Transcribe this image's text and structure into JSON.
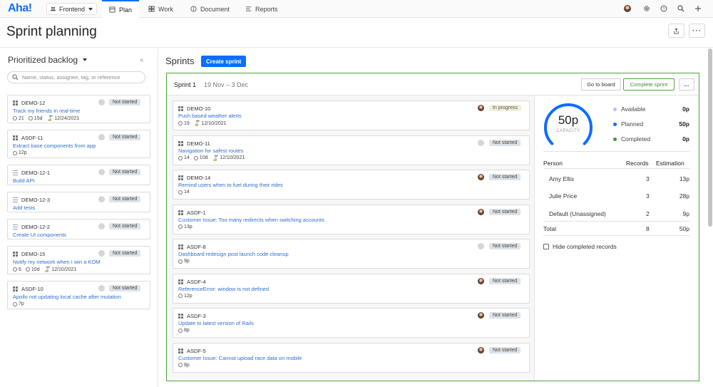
{
  "app": {
    "logo": "Aha!",
    "workspace": "Frontend",
    "tabs": [
      {
        "label": "Plan",
        "icon": "plan-icon",
        "active": true
      },
      {
        "label": "Work",
        "icon": "grid-icon",
        "active": false
      },
      {
        "label": "Document",
        "icon": "info-icon",
        "active": false
      },
      {
        "label": "Reports",
        "icon": "reports-icon",
        "active": false
      }
    ]
  },
  "page": {
    "title": "Sprint planning"
  },
  "backlog": {
    "title": "Prioritized backlog",
    "search_placeholder": "Name, status, assignee, tag, or reference",
    "items": [
      {
        "id": "DEMO-12",
        "icon": "grid",
        "title": "Track my friends in real-time",
        "status": "Not started",
        "meta": {
          "score": "21",
          "days": "15d",
          "date": "12/24/2021"
        }
      },
      {
        "id": "ASDF-11",
        "icon": "grid",
        "title": "Extract base components from app",
        "status": "Not started",
        "meta": {
          "estimate": "12p"
        }
      },
      {
        "id": "DEMO-12-1",
        "icon": "list",
        "title": "Build API",
        "status": "Not started"
      },
      {
        "id": "DEMO-12-3",
        "icon": "list",
        "title": "Add tests",
        "status": "Not started"
      },
      {
        "id": "DEMO-12-2",
        "icon": "list",
        "title": "Create UI components",
        "status": "Not started"
      },
      {
        "id": "DEMO-15",
        "icon": "grid",
        "title": "Notify my network when I win a KOM",
        "status": "Not started",
        "meta": {
          "score": "6",
          "days": "10d",
          "date": "12/10/2021"
        }
      },
      {
        "id": "ASDF-10",
        "icon": "grid",
        "title": "Apollo not updating local cache after mutation",
        "status": "Not started",
        "meta": {
          "estimate": "7p"
        }
      }
    ]
  },
  "sprints": {
    "title": "Sprints",
    "create_label": "Create sprint",
    "sprint": {
      "name": "Sprint 1",
      "dates": "19 Nov – 3 Dec",
      "go_to_board": "Go to board",
      "complete": "Complete sprint",
      "more": "…",
      "records": [
        {
          "id": "DEMO-10",
          "title": "Push based weather alerts",
          "status": "In progress",
          "avatar": "photo",
          "meta": {
            "score": "19",
            "date": "12/10/2021"
          }
        },
        {
          "id": "DEMO-11",
          "title": "Navigation for safest routes",
          "status": "Not started",
          "avatar": "blank",
          "meta": {
            "score": "14",
            "days": "10d",
            "date": "12/10/2021"
          }
        },
        {
          "id": "DEMO-14",
          "title": "Remind users when to fuel during their rides",
          "status": "Not started",
          "avatar": "photo",
          "meta": {
            "score": "14"
          }
        },
        {
          "id": "ASDF-1",
          "title": "Customer Issue: Too many redirects when switching accounts",
          "status": "Not started",
          "avatar": "photo",
          "meta": {
            "estimate": "13p"
          }
        },
        {
          "id": "ASDF-8",
          "title": "Dashboard redesign post launch code cleanup",
          "status": "Not started",
          "avatar": "blank",
          "meta": {
            "estimate": "9p"
          }
        },
        {
          "id": "ASDF-4",
          "title": "ReferenceError: window is not defined",
          "status": "Not started",
          "avatar": "photo",
          "meta": {
            "estimate": "12p"
          }
        },
        {
          "id": "ASDF-3",
          "title": "Update to latest version of Rails",
          "status": "Not started",
          "avatar": "photo",
          "meta": {
            "estimate": "8p"
          }
        },
        {
          "id": "ASDF-5",
          "title": "Customer Issue: Cannot upload race data on mobile",
          "status": "Not started",
          "avatar": "photo",
          "meta": {
            "estimate": "8p"
          }
        }
      ],
      "capacity": {
        "value": "50p",
        "label": "CAPACITY",
        "planned_fraction": 1.0,
        "legend": [
          {
            "label": "Available",
            "value": "0p",
            "color": "#a9c8ec"
          },
          {
            "label": "Planned",
            "value": "50p",
            "color": "#0d6efd"
          },
          {
            "label": "Completed",
            "value": "0p",
            "color": "#3f9b2f"
          }
        ],
        "headers": {
          "person": "Person",
          "records": "Records",
          "estimation": "Estimation"
        },
        "rows": [
          {
            "person": "Amy Ellis",
            "records": "3",
            "estimation": "13p"
          },
          {
            "person": "Julie Price",
            "records": "3",
            "estimation": "28p"
          },
          {
            "person": "Default (Unassigned)",
            "records": "2",
            "estimation": "9p"
          }
        ],
        "total": {
          "label": "Total",
          "records": "8",
          "estimation": "50p"
        },
        "hide_completed": "Hide completed records"
      }
    }
  }
}
